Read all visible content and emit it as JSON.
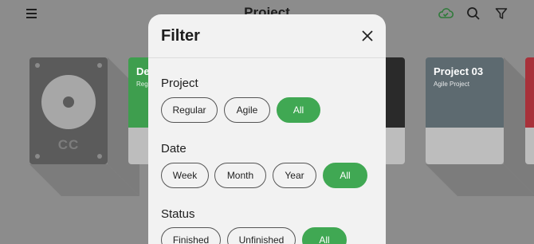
{
  "app": {
    "title": "Project",
    "cards": [
      {
        "kind": "disk",
        "label": "CC"
      },
      {
        "title": "De",
        "subtitle": "Regu",
        "color": "#3e9e4e"
      },
      {
        "title": "",
        "subtitle": "",
        "color": "#2a2a2a"
      },
      {
        "title": "Project 03",
        "subtitle": "Agile Project",
        "color": "#5d6a70"
      },
      {
        "title": "",
        "subtitle": "",
        "color": "#a8313a"
      }
    ],
    "icons": {
      "menu": "menu-icon",
      "sync": "cloud-sync-icon",
      "search": "search-icon",
      "filter": "filter-icon"
    },
    "accent": "#40a853"
  },
  "filter": {
    "title": "Filter",
    "close_icon": "close-icon",
    "sections": [
      {
        "title": "Project",
        "options": [
          "Regular",
          "Agile",
          "All"
        ],
        "selected": "All"
      },
      {
        "title": "Date",
        "options": [
          "Week",
          "Month",
          "Year",
          "All"
        ],
        "selected": "All"
      },
      {
        "title": "Status",
        "options": [
          "Finished",
          "Unfinished",
          "All"
        ],
        "selected": "All"
      }
    ]
  }
}
